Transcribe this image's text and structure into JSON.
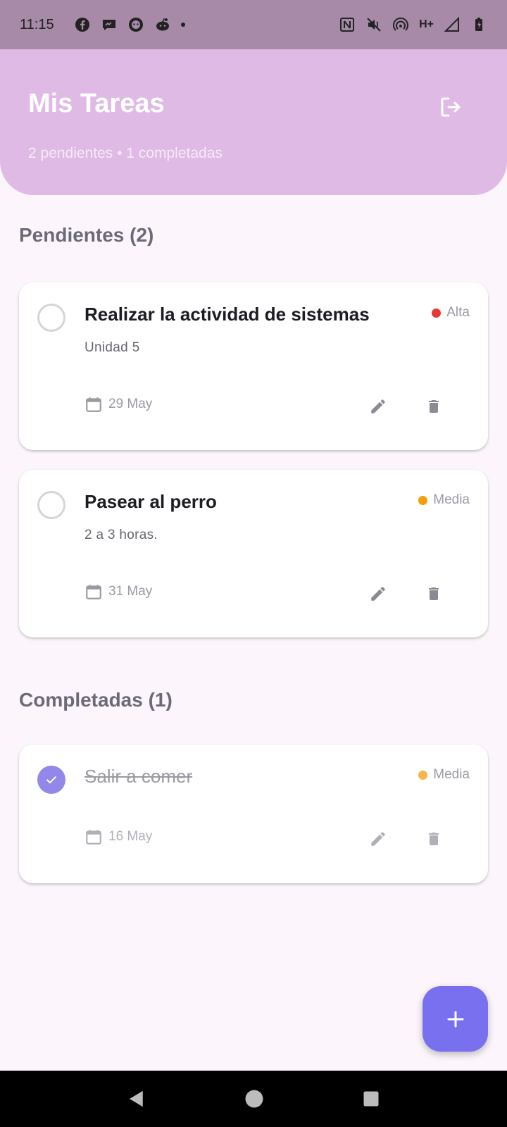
{
  "status_bar": {
    "time": "11:15",
    "left_icons": [
      "facebook-icon",
      "messenger-icon",
      "github-icon",
      "reddit-icon",
      "dot-icon"
    ],
    "right_icons": [
      "nfc-icon",
      "mute-icon",
      "hotspot-icon",
      "signal-icon",
      "battery-icon"
    ],
    "network_label": "H+"
  },
  "header": {
    "title": "Mis Tareas",
    "subtitle": "2 pendientes • 1 completadas",
    "logout_icon": "logout-icon"
  },
  "sections": {
    "pending_title": "Pendientes (2)",
    "completed_title": "Completadas (1)"
  },
  "tasks": [
    {
      "title": "Realizar la actividad de sistemas",
      "description": "Unidad 5",
      "priority": "Alta",
      "priority_color": "#e53935",
      "date": "29 May",
      "completed": false
    },
    {
      "title": "Pasear al perro",
      "description": "2 a 3 horas.",
      "priority": "Media",
      "priority_color": "#f59e0b",
      "date": "31 May",
      "completed": false
    },
    {
      "title": "Salir a comer",
      "description": "",
      "priority": "Media",
      "priority_color": "#f7b54a",
      "date": "16 May",
      "completed": true
    }
  ],
  "fab": {
    "icon": "plus-icon"
  },
  "nav": {
    "icons": [
      "back-icon",
      "home-icon",
      "recents-icon"
    ]
  },
  "colors": {
    "header_bg": "#dfbae5",
    "status_bg": "#a68aa8",
    "accent": "#7870ee",
    "check_done": "#9388ea"
  }
}
